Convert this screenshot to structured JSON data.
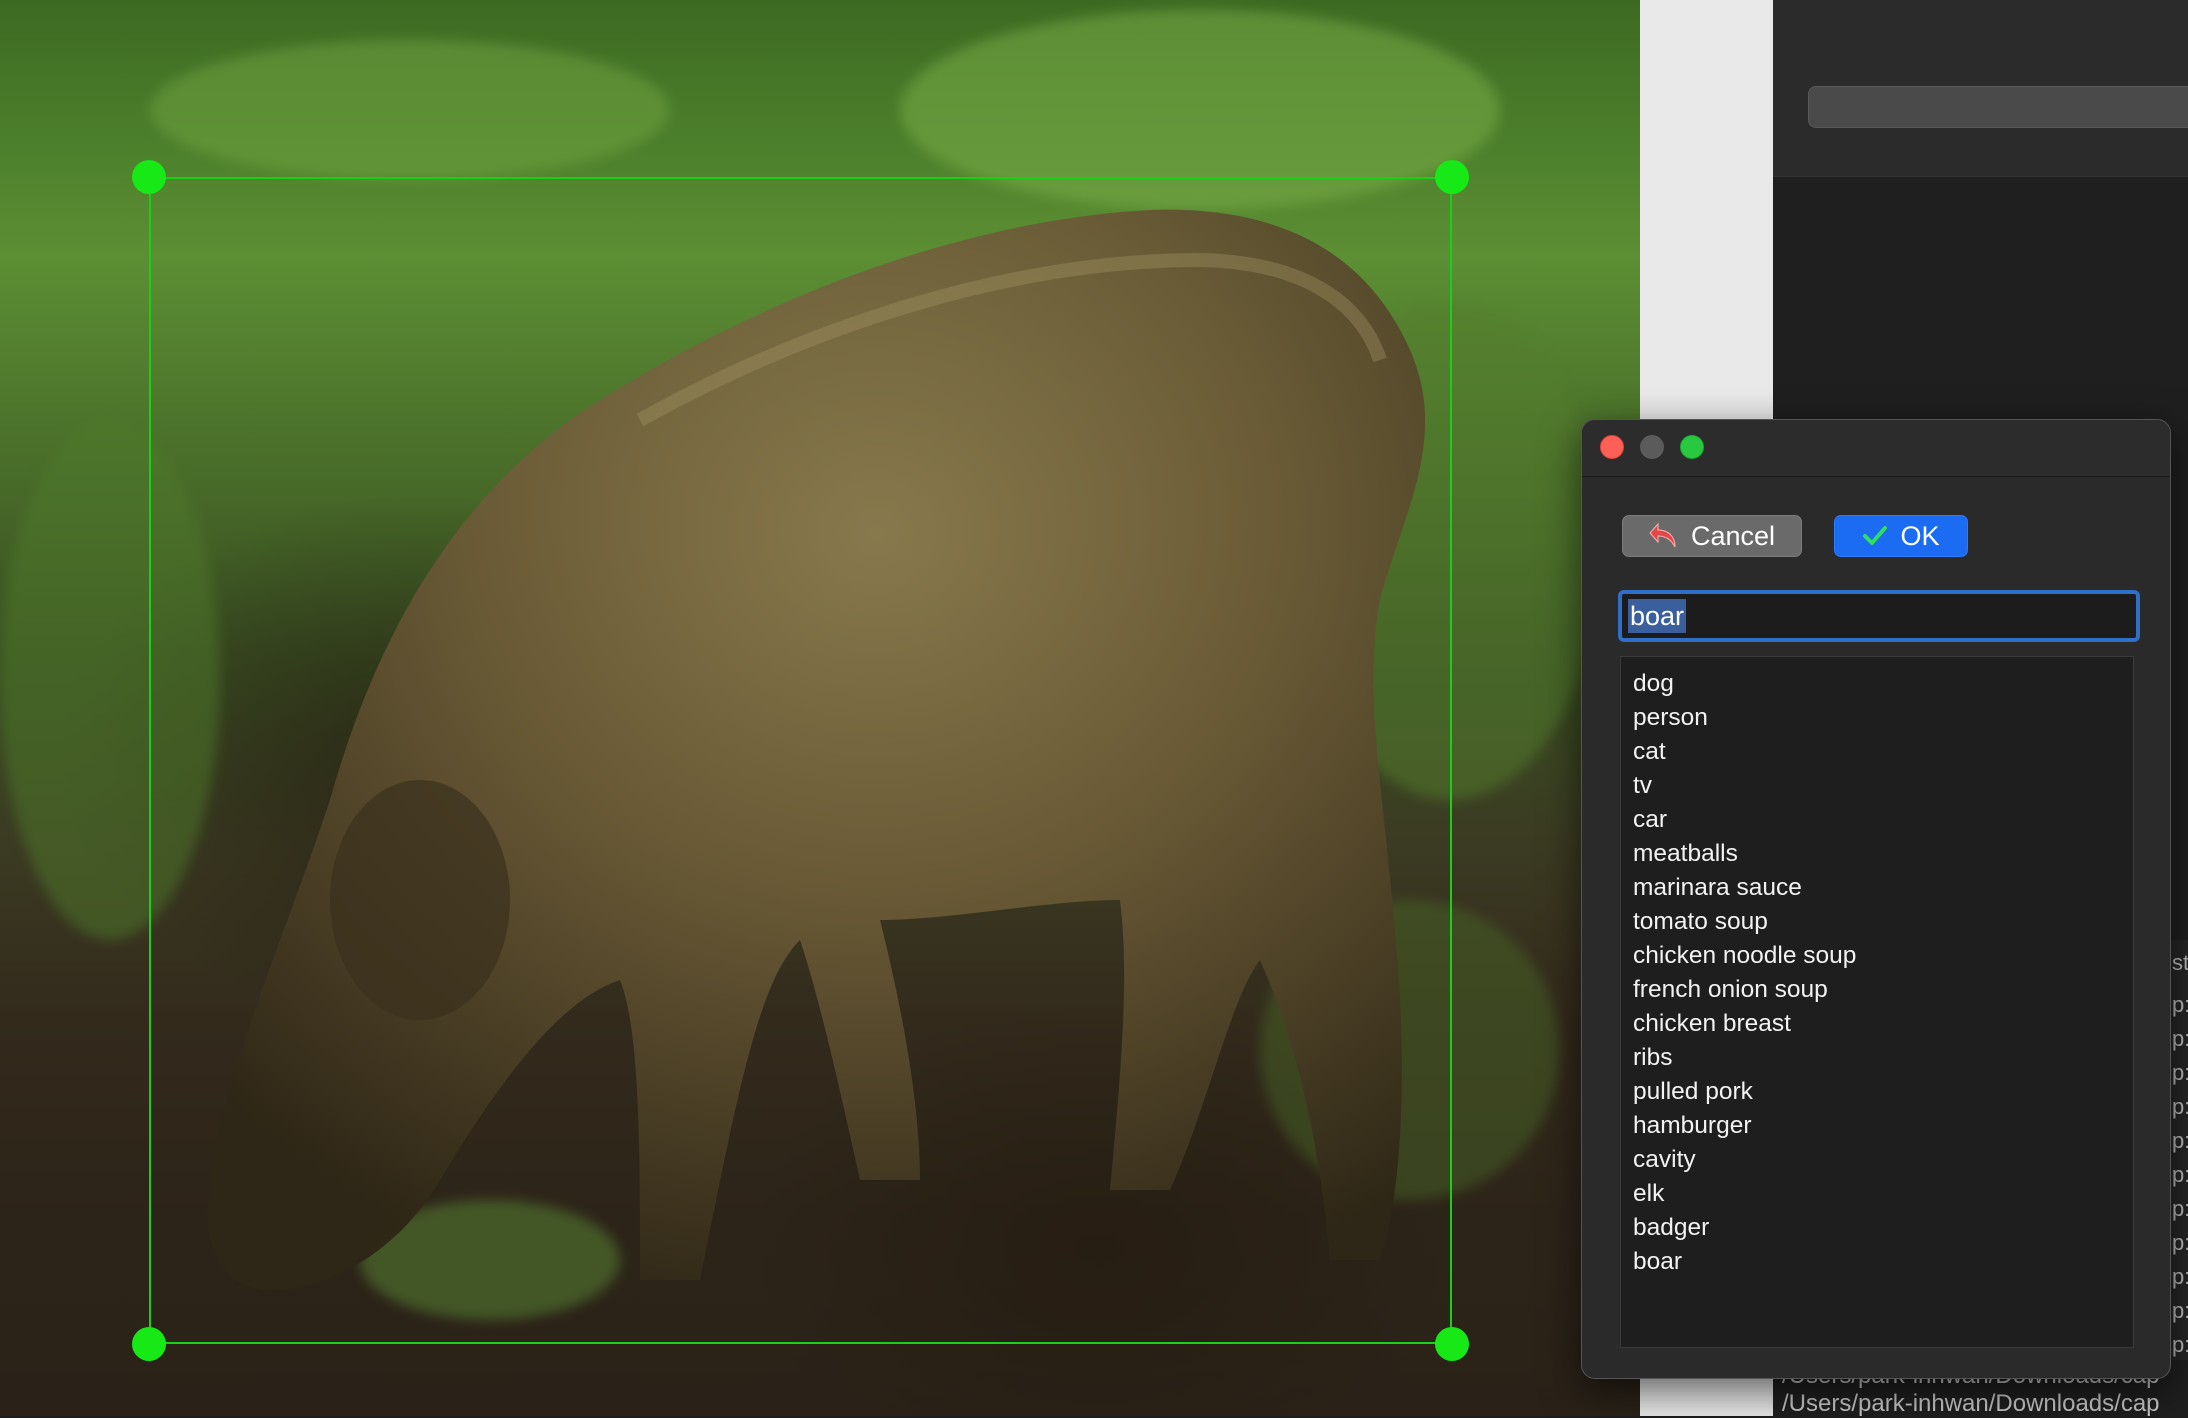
{
  "dialog": {
    "cancel_label": "Cancel",
    "ok_label": "OK",
    "input_value": "boar",
    "labels": [
      "dog",
      "person",
      "cat",
      "tv",
      "car",
      "meatballs",
      "marinara sauce",
      "tomato soup",
      "chicken noodle soup",
      "french onion soup",
      "chicken breast",
      "ribs",
      "pulled pork",
      "hamburger",
      "cavity",
      "elk",
      "badger",
      "boar"
    ]
  },
  "background": {
    "log_lines": [
      "/Users/park-inhwan/Downloads/cap",
      "/Users/park-inhwan/Downloads/cap"
    ],
    "edge_text": [
      "st",
      "p:",
      "p:",
      "p:",
      "p:",
      "p:",
      "p:",
      "p:",
      "p:",
      "p:",
      "p:",
      "p:"
    ]
  },
  "colors": {
    "bbox": "#18d018",
    "handle": "#16e916",
    "ok_button": "#1b6cf2",
    "focus_ring": "#2f6fc8"
  },
  "icons": {
    "cancel": "undo-arrow-icon",
    "ok": "checkmark-icon"
  }
}
